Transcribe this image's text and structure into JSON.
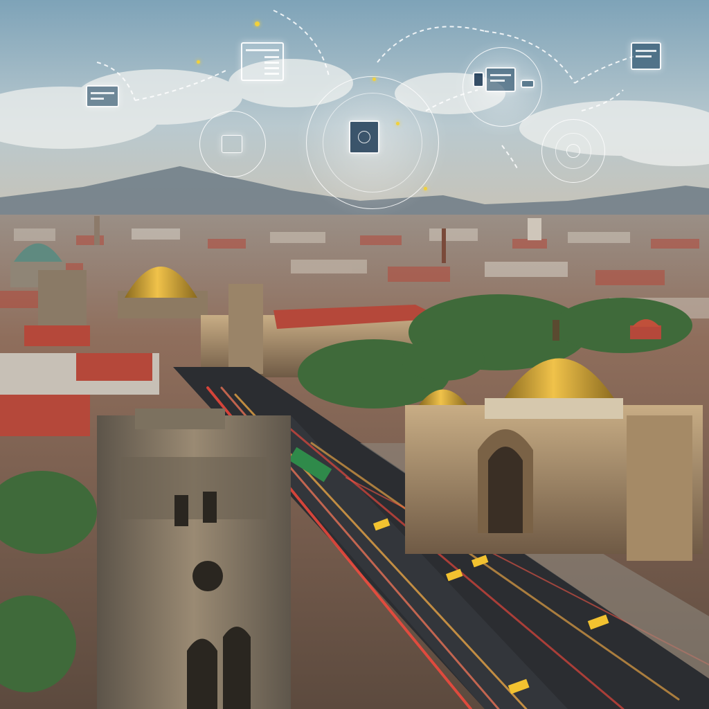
{
  "scene": {
    "description_tags": [
      "city-aerial",
      "holographic-ui-overlay"
    ],
    "colors": {
      "sky_top": "#7ea3b8",
      "sky_mid": "#b9c9cf",
      "haze": "#c9c2b4",
      "mountain": "#6d7b86",
      "roof_red": "#b5483a",
      "stone": "#b39a78",
      "dome_gold": "#d9a630",
      "tree": "#3f6a3a",
      "road": "#2b2d31",
      "light_trail_red": "#ff4a3d",
      "light_trail_amber": "#ffb347",
      "hologram": "#ffffff",
      "accent_yellow": "#f2d13a"
    },
    "icons": [
      "monitor-icon",
      "document-window-icon",
      "target-icon",
      "chip-icon",
      "browser-window-icon",
      "laptop-icon"
    ]
  }
}
